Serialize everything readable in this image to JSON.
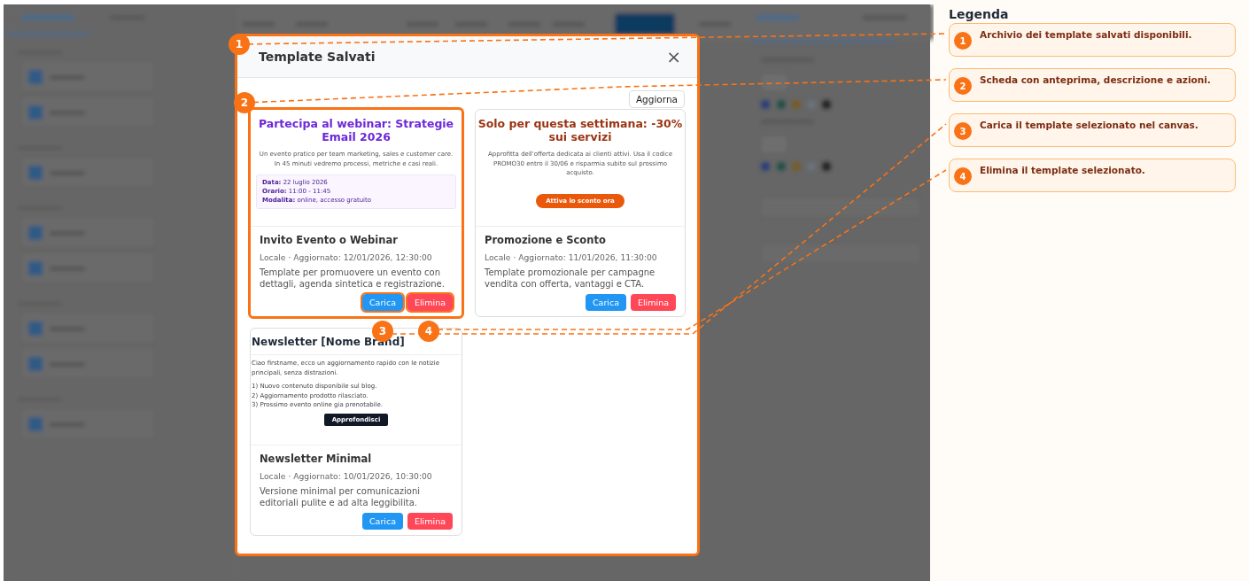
{
  "modal": {
    "title": "Template Salvati",
    "close_icon": "×",
    "refresh_button": "Aggiorna",
    "templates": [
      {
        "preview": {
          "kind": "event",
          "title": "Partecipa al webinar: Strategie Email 2026",
          "intro": "Un evento pratico per team marketing, sales e customer care. In 45 minuti vedremo processi, metriche e casi reali.",
          "details": [
            "**Data:** 22 luglio 2026",
            "**Orario:** 11:00 - 11:45",
            "**Modalita:** online, accesso gratuito"
          ]
        },
        "name": "Invito Evento o Webinar",
        "meta": "Locale · Aggiornato: 12/01/2026, 12:30:00",
        "description": "Template per promuovere un evento con dettagli, agenda sintetica e registrazione.",
        "load_button": "Carica",
        "delete_button": "Elimina",
        "highlighted": true,
        "load_highlighted": true,
        "delete_highlighted": true
      },
      {
        "preview": {
          "kind": "promo",
          "title": "Solo per questa settimana: -30% sui servizi",
          "intro": "Approfitta dell'offerta dedicata ai clienti attivi. Usa il codice PROMO30 entro il 30/06 e risparmia subito sul prossimo acquisto.",
          "cta": "Attiva lo sconto ora"
        },
        "name": "Promozione e Sconto",
        "meta": "Locale · Aggiornato: 11/01/2026, 11:30:00",
        "description": "Template promozionale per campagne vendita con offerta, vantaggi e CTA.",
        "load_button": "Carica",
        "delete_button": "Elimina",
        "highlighted": false,
        "load_highlighted": false,
        "delete_highlighted": false
      },
      {
        "preview": {
          "kind": "newsletter",
          "title": "Newsletter [Nome Brand]",
          "intro": "Ciao firstname, ecco un aggiornamento rapido con le notizie principali, senza distrazioni.",
          "details": [
            "1) Nuovo contenuto disponibile sul blog.",
            "2) Aggiornamento prodotto rilasciato.",
            "3) Prossimo evento online gia prenotabile."
          ],
          "cta": "Approfondisci"
        },
        "name": "Newsletter Minimal",
        "meta": "Locale · Aggiornato: 10/01/2026, 10:30:00",
        "description": "Versione minimal per comunicazioni editoriali pulite e ad alta leggibilita.",
        "load_button": "Carica",
        "delete_button": "Elimina",
        "highlighted": false,
        "load_highlighted": false,
        "delete_highlighted": false
      }
    ]
  },
  "annotations": [
    {
      "number": "1"
    },
    {
      "number": "2"
    },
    {
      "number": "3"
    },
    {
      "number": "4"
    }
  ],
  "legend": {
    "title": "Legenda",
    "items": [
      {
        "number": "1",
        "text": "Archivio dei template salvati disponibili."
      },
      {
        "number": "2",
        "text": "Scheda con anteprima, descrizione e azioni."
      },
      {
        "number": "3",
        "text": "Carica il template selezionato nel canvas."
      },
      {
        "number": "4",
        "text": "Elimina il template selezionato."
      }
    ]
  }
}
